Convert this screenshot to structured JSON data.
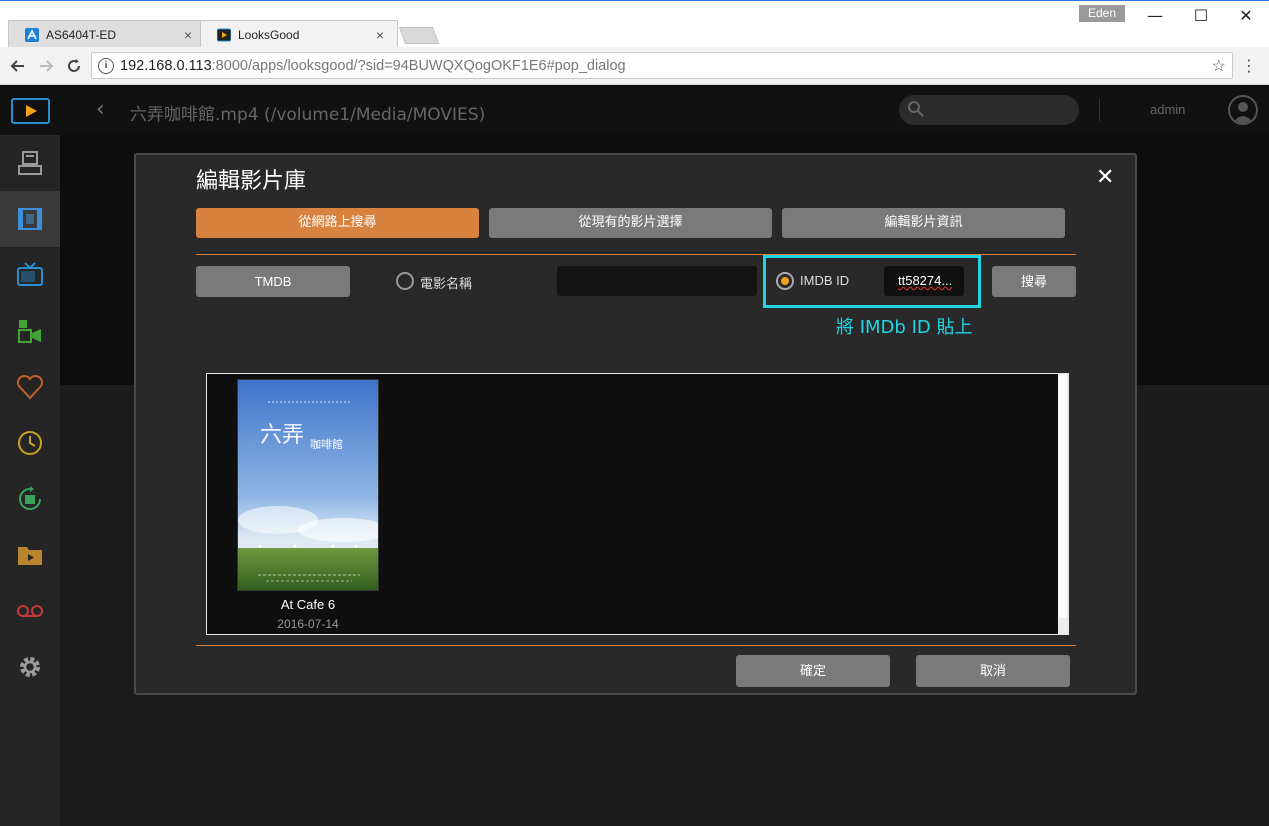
{
  "browser": {
    "tabs": [
      {
        "label": "AS6404T-ED",
        "close": "×"
      },
      {
        "label": "LooksGood",
        "close": "×"
      }
    ],
    "user_badge": "Eden",
    "window_controls": {
      "minimize": "—",
      "maximize": "☐",
      "close": "✕"
    },
    "url_host": "192.168.0.113",
    "url_rest": ":8000/apps/looksgood/?sid=94BUWQXQogOKF1E6#pop_dialog"
  },
  "app": {
    "header_title": "六弄咖啡館.mp4 (/volume1/Media/MOVIES)",
    "user": "admin"
  },
  "sidebar": {
    "items": [
      {
        "name": "library-icon",
        "color": "#9a9a9a"
      },
      {
        "name": "movies-icon",
        "color": "#3d8fd8"
      },
      {
        "name": "tv-icon",
        "color": "#2a8fd0"
      },
      {
        "name": "camera-icon",
        "color": "#3fa636"
      },
      {
        "name": "heart-icon",
        "color": "#c2602c"
      },
      {
        "name": "clock-icon",
        "color": "#c9a224"
      },
      {
        "name": "replay-icon",
        "color": "#3aa45c"
      },
      {
        "name": "folder-icon",
        "color": "#b8842f"
      },
      {
        "name": "record-icon",
        "color": "#c23a3a"
      },
      {
        "name": "gear-icon",
        "color": "#9a9a9a"
      }
    ]
  },
  "dialog": {
    "title": "編輯影片庫",
    "close": "✕",
    "tabs": [
      "從網路上搜尋",
      "從現有的影片選擇",
      "編輯影片資訊"
    ],
    "provider": "TMDB",
    "radio_name_label": "電影名稱",
    "radio_imdb_label": "IMDB ID",
    "imdb_value": "tt58274...",
    "search_button": "搜尋",
    "annotation": "將 IMDb ID 貼上",
    "results": [
      {
        "title": "At Cafe 6",
        "date": "2016-07-14"
      }
    ],
    "confirm": "確定",
    "cancel": "取消"
  },
  "colors": {
    "accent": "#d8823f",
    "highlight": "#20d6e3",
    "radio_selected": "#f4a21b"
  }
}
